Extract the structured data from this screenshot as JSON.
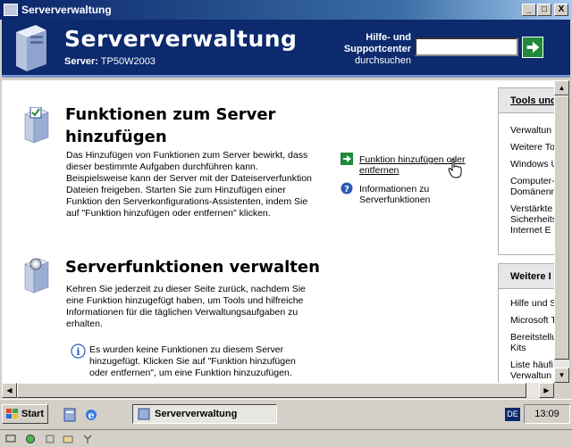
{
  "window": {
    "title": "Serververwaltung",
    "min_glyph": "_",
    "max_glyph": "□",
    "close_glyph": "X"
  },
  "header": {
    "title": "Serververwaltung",
    "server_label": "Server:",
    "server_name": "TP50W2003",
    "help_line1": "Hilfe- und",
    "help_line2": "Supportcenter",
    "help_line3": "durchsuchen",
    "search_value": ""
  },
  "sections": {
    "add": {
      "title_line1": "Funktionen zum Server",
      "title_line2": "hinzufügen",
      "text": [
        "Das Hinzufügen von Funktionen zum Server bewirkt, dass",
        "dieser bestimmte Aufgaben durchführen kann.",
        "Beispielsweise kann der Server mit der Dateiserverfunktion",
        "Dateien freigeben. Starten Sie zum Hinzufügen einer",
        "Funktion den Serverkonfigurations-Assistenten, indem Sie",
        "auf \"Funktion hinzufügen oder entfernen\" klicken."
      ],
      "task1_line1": "Funktion hinzufügen oder",
      "task1_line2": "entfernen",
      "task2_line1": "Informationen zu",
      "task2_line2": "Serverfunktionen"
    },
    "manage": {
      "title": "Serverfunktionen verwalten",
      "text": [
        "Kehren Sie jederzeit zu dieser Seite zurück, nachdem Sie",
        "eine Funktion hinzugefügt haben, um Tools und hilfreiche",
        "Informationen für die täglichen Verwaltungsaufgaben zu",
        "erhalten."
      ],
      "info": [
        "Es wurden keine Funktionen zu diesem Server",
        "hinzugefügt. Klicken Sie auf \"Funktion hinzufügen",
        "oder entfernen\", um eine Funktion hinzuzufügen."
      ]
    }
  },
  "right_pane": {
    "tools": {
      "heading": "Tools und",
      "items": [
        "Verwaltun",
        "Weitere To",
        "Windows U",
        "Computer-",
        "Domänenn",
        "Verstärkte",
        "Sicherheits",
        "Internet E"
      ]
    },
    "more": {
      "heading": "Weitere I",
      "items": [
        "Hilfe und S",
        "Microsoft T",
        "Bereitstellu",
        "Kits",
        "Liste häufi",
        "Verwaltun"
      ]
    }
  },
  "taskbar": {
    "start_label": "Start",
    "task_label": "Serververwaltung",
    "lang": "DE",
    "clock": "13:09"
  },
  "colors": {
    "title_gradient_start": "#0a246a",
    "header_bg": "#0c2a6d",
    "go_button": "#1f8a3a",
    "chrome": "#d4d0c8"
  }
}
